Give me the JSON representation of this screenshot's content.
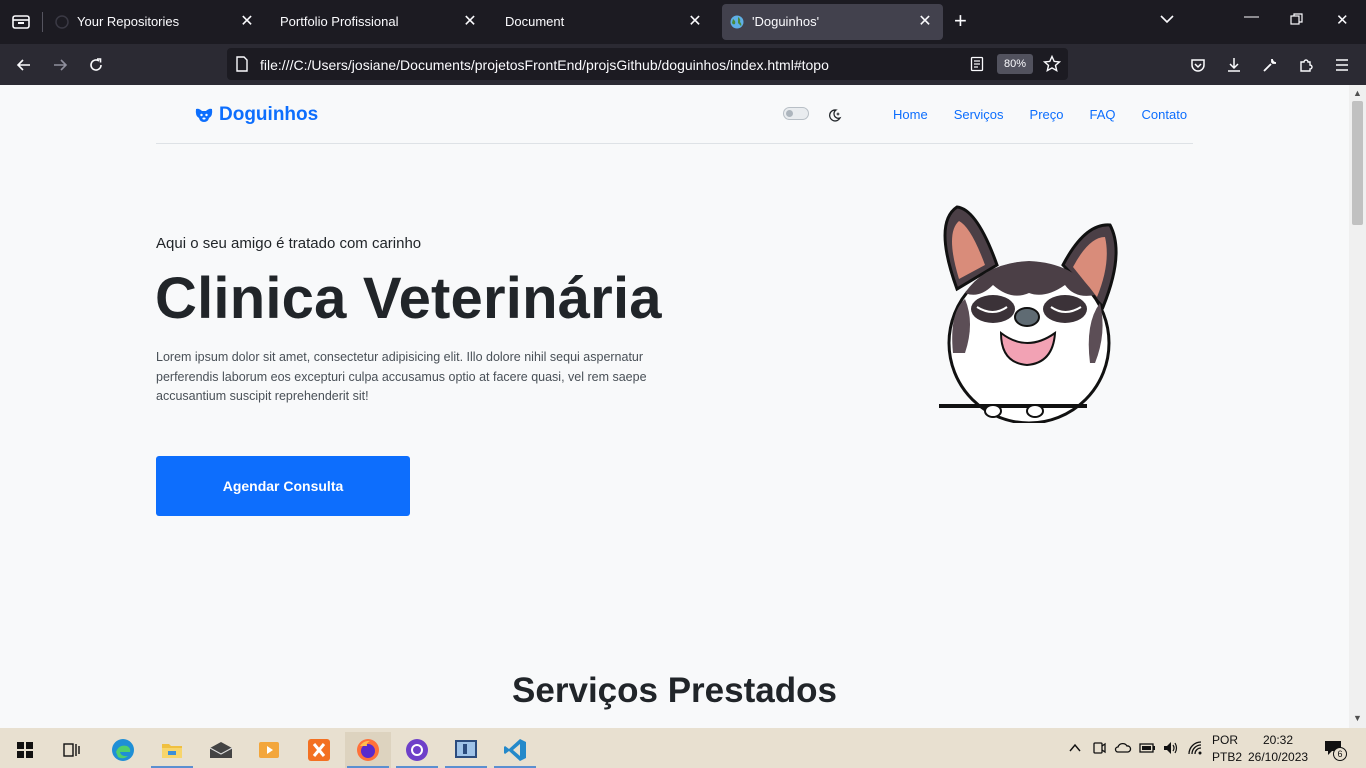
{
  "browser": {
    "tabs": [
      {
        "title": "Your Repositories",
        "active": false
      },
      {
        "title": "Portfolio Profissional",
        "active": false
      },
      {
        "title": "Document",
        "active": false
      },
      {
        "title": "'Doguinhos'",
        "active": true
      }
    ],
    "url": "file:///C:/Users/josiane/Documents/projetosFrontEnd/projsGithub/doguinhos/index.html#topo",
    "zoom": "80%"
  },
  "site": {
    "brand": "Doguinhos",
    "nav": [
      "Home",
      "Serviços",
      "Preço",
      "FAQ",
      "Contato"
    ],
    "hero": {
      "subtitle": "Aqui o seu amigo é tratado com carinho",
      "title": "Clinica Veterinária",
      "text": "Lorem ipsum dolor sit amet, consectetur adipisicing elit. Illo dolore nihil sequi aspernatur perferendis laborum eos excepturi culpa accusamus optio at facere quasi, vel rem saepe accusantium suscipit reprehenderit sit!",
      "cta": "Agendar Consulta"
    },
    "section_title": "Serviços Prestados",
    "colors": {
      "primary": "#0d6efd",
      "background": "#f8f9fa",
      "text": "#212529"
    }
  },
  "taskbar": {
    "language": "POR",
    "layout": "PTB2",
    "time": "20:32",
    "date": "26/10/2023",
    "notifications": "6"
  }
}
